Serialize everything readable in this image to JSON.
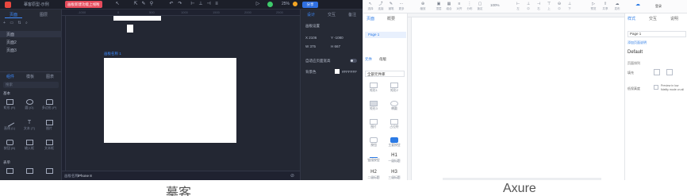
{
  "mockplus": {
    "title": "摹客原型-示例",
    "badge": "画板新建功能上线啦",
    "zoom": "25%",
    "left_tabs": [
      "页面",
      "图层"
    ],
    "pages": [
      "页面",
      "页面2",
      "页面3"
    ],
    "lib_tabs": [
      "组件",
      "模板",
      "图表"
    ],
    "search_placeholder": "搜索",
    "section_basic": "基本",
    "components": [
      {
        "label": "矩形 (R)"
      },
      {
        "label": "圆 (O)"
      },
      {
        "label": "多边形 (P)"
      },
      {
        "label": "直线 (L)"
      },
      {
        "label": "文本 (T)"
      },
      {
        "label": "图片"
      },
      {
        "label": "按钮 (B)"
      },
      {
        "label": "输入框"
      },
      {
        "label": "文本框"
      }
    ],
    "section_form": "表单",
    "artboard_label": "画板名称 1",
    "bottom_label": "画板名称",
    "bottom_value": "iPhone 8",
    "right_tabs": [
      "设计",
      "交互",
      "备注"
    ],
    "props": {
      "header": "画板设置",
      "x": "X 2106",
      "y": "Y -1080",
      "w": "W 375",
      "h": "H 667",
      "auto_height": "自适应页面宽高",
      "bg_label": "背景色",
      "bg_value": "#FFFFFF"
    },
    "ruler_ticks": [
      "-1000",
      "0",
      "500",
      "1000",
      "1500",
      "2000",
      "2500"
    ]
  },
  "axure": {
    "toolbar": [
      "选择",
      "连接",
      "钢笔",
      "更多",
      "缩放",
      "顶层",
      "组合",
      "对齐",
      "分布",
      "锁定",
      "左",
      "中",
      "右",
      "上",
      "中",
      "下",
      "预览",
      "共享",
      "发布"
    ],
    "zoom": "100%",
    "user": "登录",
    "left_tabs": [
      "页面",
      "概要"
    ],
    "page_item": "Page 1",
    "lib_tabs": [
      "元件",
      "母版"
    ],
    "lib_select": "全部元件库",
    "items": [
      {
        "label": "矩形1"
      },
      {
        "label": "矩形2"
      },
      {
        "label": "矩形3"
      },
      {
        "label": "椭圆"
      },
      {
        "label": "图片"
      },
      {
        "label": "占位符"
      },
      {
        "label": "按钮"
      },
      {
        "label": "主要按钮"
      },
      {
        "label": "链接按钮"
      },
      {
        "label": "一级标题"
      },
      {
        "label": "二级标题"
      },
      {
        "label": "三级标题"
      }
    ],
    "h_labels": [
      "H1",
      "H2",
      "H3"
    ],
    "right_tabs": [
      "样式",
      "交互",
      "说明"
    ],
    "page_name": "Page 1",
    "add_link": "添加页面说明",
    "style_name": "Default",
    "prop_labels": [
      "页面排列",
      "填充",
      "低保真度"
    ],
    "prop_hint": "Preview in low fidelity mode on all"
  },
  "captions": {
    "left": "摹客",
    "right": "Axure"
  },
  "colors": {
    "mockplus_bg": "#232733",
    "mockplus_accent": "#3d8bff",
    "mockplus_badge": "#e64b5c",
    "axure_accent": "#2c7be5"
  }
}
